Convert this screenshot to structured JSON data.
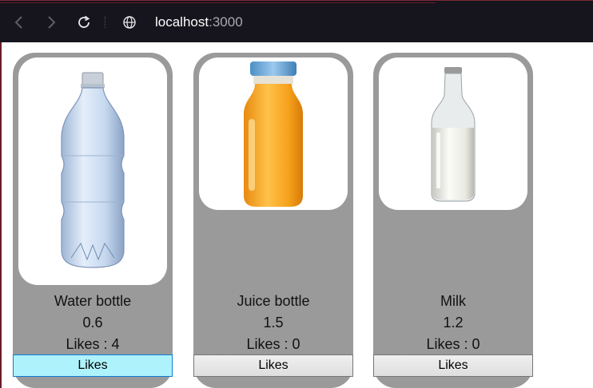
{
  "browser": {
    "url_host": "localhost",
    "url_port": ":3000",
    "icons": {
      "back": "arrow-left-icon",
      "forward": "arrow-right-icon",
      "reload": "reload-icon",
      "site": "globe-icon"
    }
  },
  "products": [
    {
      "name": "Water bottle",
      "price": "0.6",
      "likes_text": "Likes : 4",
      "button_label": "Likes",
      "image": "water-bottle-image"
    },
    {
      "name": "Juice bottle",
      "price": "1.5",
      "likes_text": "Likes : 0",
      "button_label": "Likes",
      "image": "juice-bottle-image"
    },
    {
      "name": "Milk",
      "price": "1.2",
      "likes_text": "Likes : 0",
      "button_label": "Likes",
      "image": "milk-bottle-image"
    }
  ],
  "colors": {
    "card_background": "#9a9a9a",
    "toolbar_background": "#16141d",
    "active_button": "#aef3fb"
  }
}
